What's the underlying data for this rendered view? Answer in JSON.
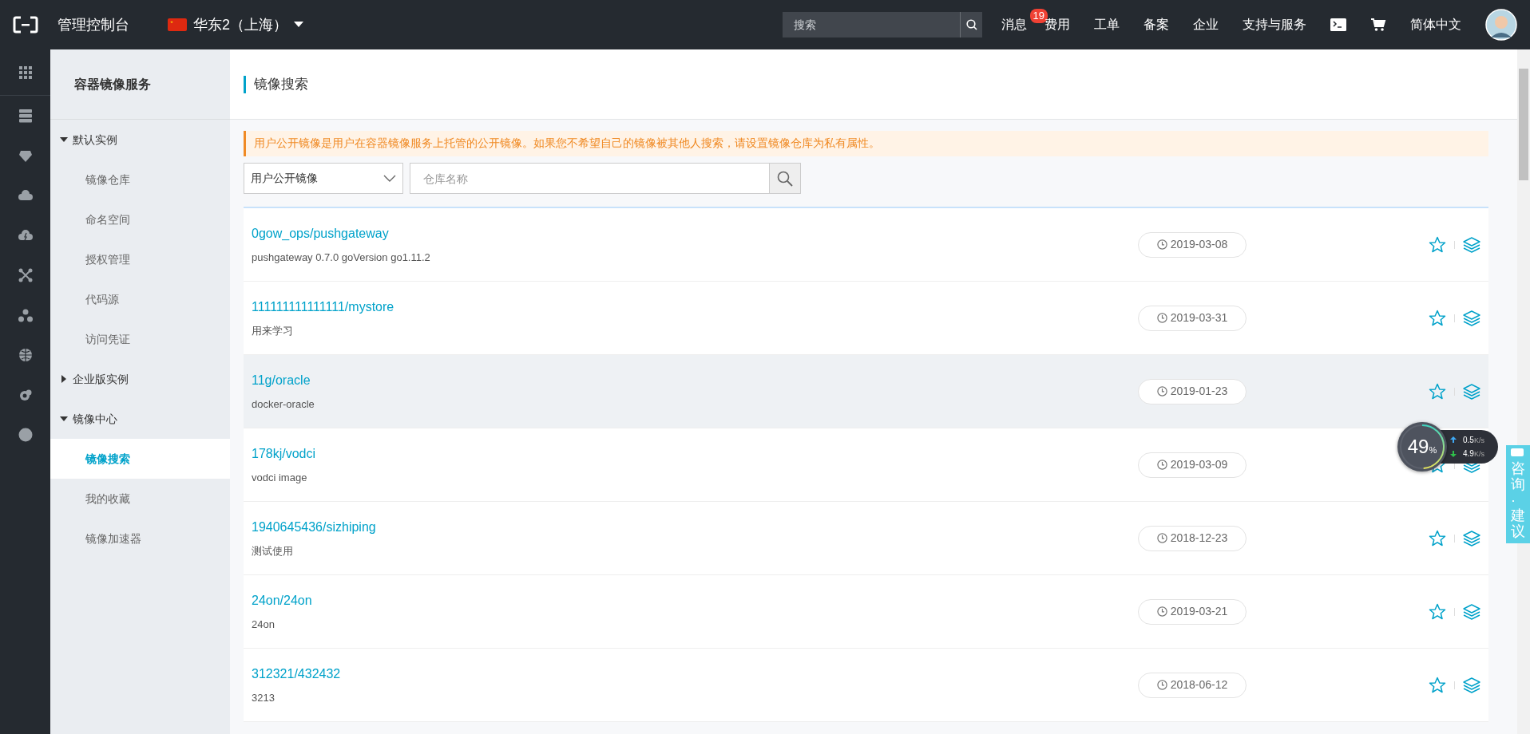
{
  "topbar": {
    "console_title": "管理控制台",
    "region": "华东2（上海）",
    "search": {
      "placeholder": "搜索"
    },
    "nav": [
      {
        "kind": "text",
        "label": "消息",
        "badge": "19"
      },
      {
        "kind": "text",
        "label": "费用"
      },
      {
        "kind": "text",
        "label": "工单"
      },
      {
        "kind": "text",
        "label": "备案"
      },
      {
        "kind": "text",
        "label": "企业"
      },
      {
        "kind": "text",
        "label": "支持与服务"
      },
      {
        "kind": "terminal"
      },
      {
        "kind": "cart"
      },
      {
        "kind": "text",
        "label": "简体中文"
      },
      {
        "kind": "avatar"
      }
    ]
  },
  "rail": [
    {
      "kind": "grid"
    },
    {
      "kind": "server"
    },
    {
      "kind": "shield"
    },
    {
      "kind": "cloud"
    },
    {
      "kind": "cloud-bolt"
    },
    {
      "kind": "network"
    },
    {
      "kind": "cluster"
    },
    {
      "kind": "globe"
    },
    {
      "kind": "gear-cloud"
    },
    {
      "kind": "dot"
    }
  ],
  "sidebar": {
    "title": "容器镜像服务",
    "groups": [
      {
        "label": "默认实例",
        "expanded": true,
        "children": [
          {
            "label": "镜像仓库",
            "selected": false
          },
          {
            "label": "命名空间",
            "selected": false
          },
          {
            "label": "授权管理",
            "selected": false
          },
          {
            "label": "代码源",
            "selected": false
          },
          {
            "label": "访问凭证",
            "selected": false
          }
        ]
      },
      {
        "label": "企业版实例",
        "expanded": false
      },
      {
        "label": "镜像中心",
        "expanded": true,
        "children": [
          {
            "label": "镜像搜索",
            "selected": true
          },
          {
            "label": "我的收藏",
            "selected": false
          },
          {
            "label": "镜像加速器",
            "selected": false
          }
        ]
      }
    ]
  },
  "page": {
    "title": "镜像搜索",
    "notice": "用户公开镜像是用户在容器镜像服务上托管的公开镜像。如果您不希望自己的镜像被其他人搜索，请设置镜像仓库为私有属性。",
    "filter": {
      "value": "用户公开镜像"
    },
    "search": {
      "placeholder": "仓库名称"
    }
  },
  "repositories": [
    {
      "name": "0gow_ops/pushgateway",
      "description": "pushgateway 0.7.0 goVersion go1.11.2",
      "date": "2019-03-08",
      "highlighted": false
    },
    {
      "name": "111111111111111/mystore",
      "description": "用来学习",
      "date": "2019-03-31",
      "highlighted": false
    },
    {
      "name": "11g/oracle",
      "description": "docker-oracle",
      "date": "2019-01-23",
      "highlighted": true
    },
    {
      "name": "178kj/vodci",
      "description": "vodci image",
      "date": "2019-03-09",
      "highlighted": false
    },
    {
      "name": "1940645436/sizhiping",
      "description": "测试使用",
      "date": "2018-12-23",
      "highlighted": false
    },
    {
      "name": "24on/24on",
      "description": "24on",
      "date": "2019-03-21",
      "highlighted": false
    },
    {
      "name": "312321/432432",
      "description": "3213",
      "date": "2018-06-12",
      "highlighted": false
    }
  ],
  "net_monitor": {
    "percent": "49",
    "percent_sign": "%",
    "level": 0.49,
    "upload": {
      "value": "0.5",
      "unit": "K/s"
    },
    "download": {
      "value": "4.9",
      "unit": "K/s"
    }
  },
  "feedback_tab": {
    "label": "咨询·建议"
  }
}
